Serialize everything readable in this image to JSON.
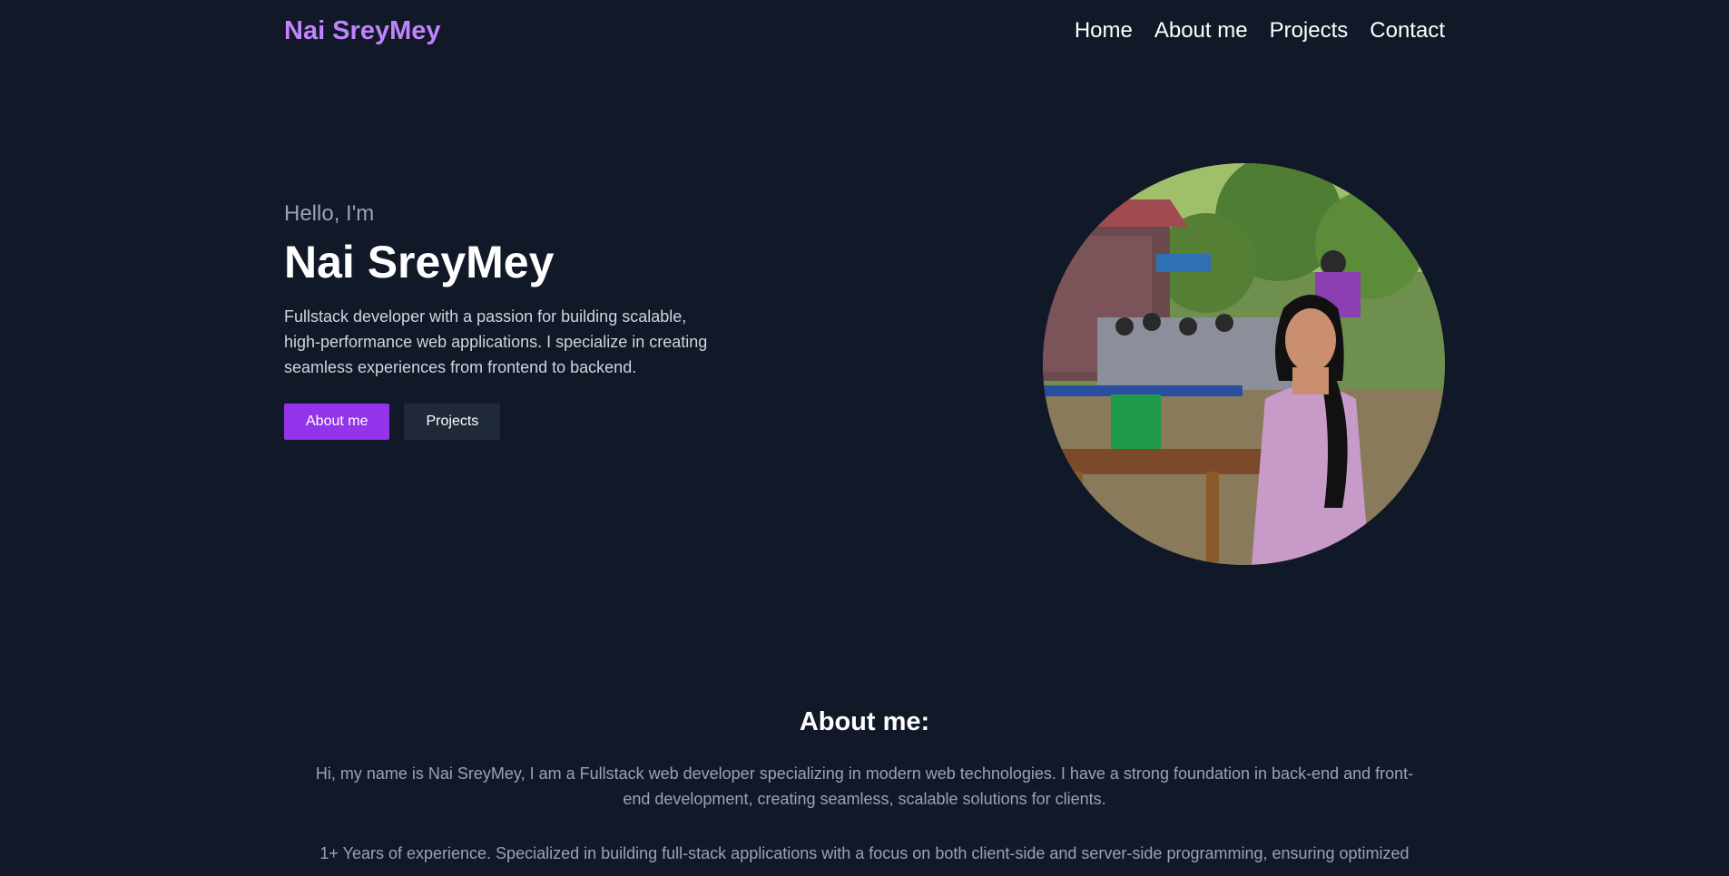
{
  "header": {
    "brand": "Nai SreyMey",
    "nav": [
      "Home",
      "About me",
      "Projects",
      "Contact"
    ]
  },
  "hero": {
    "greeting": "Hello, I'm",
    "name": "Nai SreyMey",
    "description": "Fullstack developer with a passion for building scalable, high-performance web applications. I specialize in creating seamless experiences from frontend to backend.",
    "buttons": {
      "primary": "About me",
      "secondary": "Projects"
    },
    "photo_icon": "profile-photo"
  },
  "about": {
    "title": "About me:",
    "paragraphs": [
      "Hi, my name is Nai SreyMey, I am a Fullstack web developer specializing in modern web technologies. I have a strong foundation in back-end and front-end development, creating seamless, scalable solutions for clients.",
      "1+ Years of experience. Specialized in building full-stack applications with a focus on both client-side and server-side programming, ensuring optimized"
    ]
  },
  "colors": {
    "background": "#111827",
    "brand": "#c084fc",
    "primary_button": "#9333ea",
    "secondary_button": "#1f2937"
  }
}
